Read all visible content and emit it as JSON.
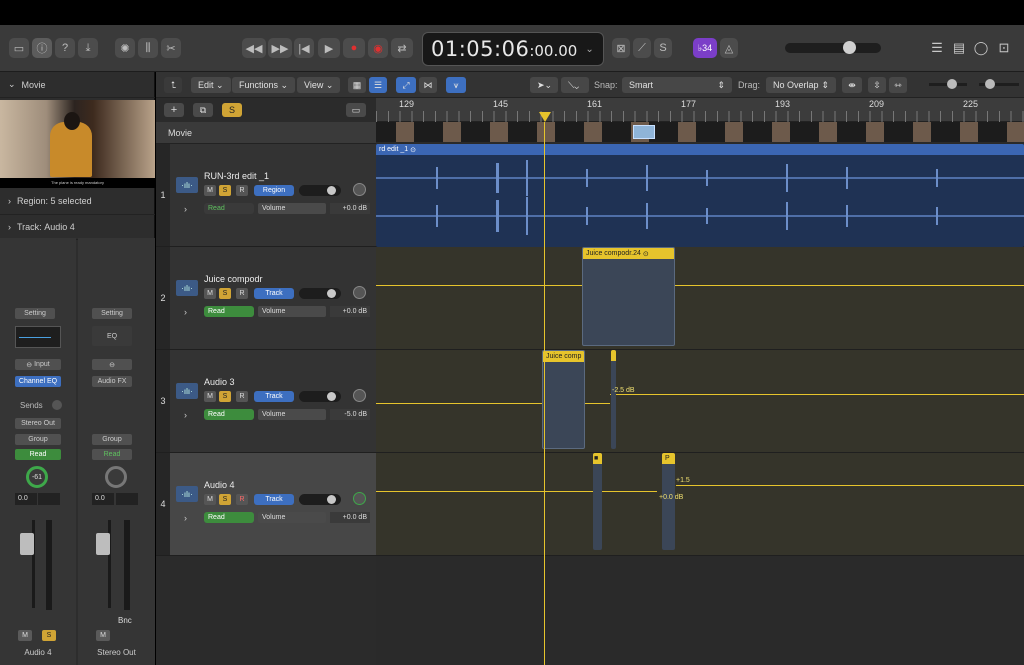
{
  "lcd": {
    "main": "01:05:06",
    "sub": ":00.00",
    "key": "♭34"
  },
  "control_bar": {
    "edit": "Edit",
    "functions": "Functions",
    "view": "View",
    "snap_label": "Snap:",
    "snap_value": "Smart",
    "drag_label": "Drag:",
    "drag_value": "No Overlap"
  },
  "inspector": {
    "movie_title": "Movie",
    "subtitle_caption": "The plane is ready mandatory",
    "region_label": "Region:",
    "region_value": "5 selected",
    "track_label": "Track:",
    "track_value": "Audio 4"
  },
  "strips": [
    {
      "setting": "Setting",
      "io": "Input",
      "insert": "Channel EQ",
      "sends": "Sends",
      "output": "Stereo Out",
      "group": "Group",
      "automation": "Read",
      "pan": "-61",
      "level": "0.0",
      "mute": "M",
      "solo": "S",
      "name": "Audio 4"
    },
    {
      "setting": "Setting",
      "io": "",
      "insert": "EQ",
      "sends": "",
      "output": "Audio FX",
      "group": "Group",
      "automation": "Read",
      "pan": "",
      "level": "0.0",
      "mute": "M",
      "solo": "",
      "bounce": "Bnc",
      "name": "Stereo Out"
    }
  ],
  "header": {
    "movie_label": "Movie",
    "add": "+",
    "solo": "S"
  },
  "ruler": [
    "129",
    "145",
    "161",
    "177",
    "193",
    "209",
    "225"
  ],
  "tracks": [
    {
      "num": "1",
      "name": "RUN-3rd edit _1",
      "mode": "Region",
      "automation": "Read",
      "param": "Volume",
      "value": "+0.0 dB"
    },
    {
      "num": "2",
      "name": "Juice compodr",
      "mode": "Track",
      "automation": "Read",
      "param": "Volume",
      "value": "+0.0 dB"
    },
    {
      "num": "3",
      "name": "Audio 3",
      "mode": "Track",
      "automation": "Read",
      "param": "Volume",
      "value": "-5.0 dB"
    },
    {
      "num": "4",
      "name": "Audio 4",
      "mode": "Track",
      "automation": "Read",
      "param": "Volume",
      "value": "+0.0 dB"
    }
  ],
  "msr": {
    "m": "M",
    "s": "S",
    "r": "R"
  },
  "regions": {
    "r1": "rd edit _1",
    "r2": "Juice compodr.24",
    "r3": "Juice comp",
    "r4a": "■",
    "r4b": "P"
  },
  "auto_labels": {
    "a3": "-2.5 dB",
    "a4a": "+1.5",
    "a4b": "+0.0 dB"
  },
  "colors": {
    "accent": "#e6c42c",
    "blue": "#3d6fc0",
    "green": "#3d8c3d"
  }
}
